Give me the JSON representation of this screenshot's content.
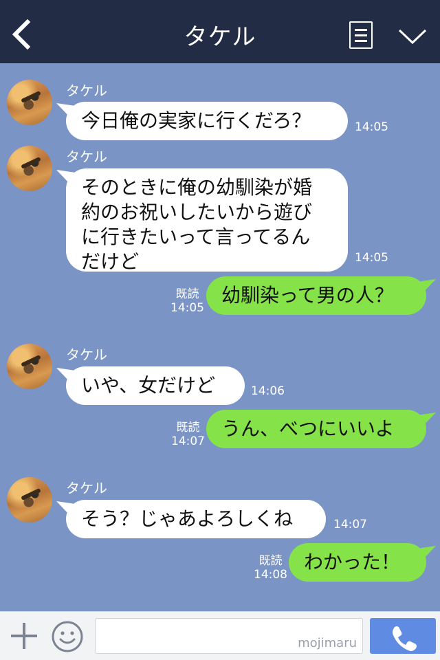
{
  "header": {
    "title": "タケル"
  },
  "messages": [
    {
      "sender": "タケル",
      "text": "今日俺の実家に行くだろ？",
      "time": "14:05"
    },
    {
      "sender": "タケル",
      "lines": [
        "そのときに俺の幼馴染が婚",
        "約のお祝いしたいから遊び",
        "に行きたいって言ってるん",
        "だけど"
      ],
      "time": "14:05"
    },
    {
      "text": "幼馴染って男の人？",
      "read": "既読",
      "time": "14:05"
    },
    {
      "sender": "タケル",
      "text": "いや、女だけど",
      "time": "14:06"
    },
    {
      "text": "うん、べつにいいよ",
      "read": "既読",
      "time": "14:07"
    },
    {
      "sender": "タケル",
      "text": "そう？じゃあよろしくね",
      "time": "14:07"
    },
    {
      "text": "わかった！",
      "read": "既読",
      "time": "14:08"
    }
  ],
  "input": {
    "watermark": "mojimaru"
  },
  "colors": {
    "header": "#232c45",
    "chat_bg": "#7b94c6",
    "incoming_bubble": "#ffffff",
    "outgoing_bubble": "#85e249",
    "call_button": "#5f8be3"
  },
  "icons": {
    "back": "chevron-left-icon",
    "menu": "menu-list-icon",
    "collapse": "chevron-down-icon",
    "add": "plus-icon",
    "emoji": "smiley-icon",
    "call": "phone-icon"
  }
}
